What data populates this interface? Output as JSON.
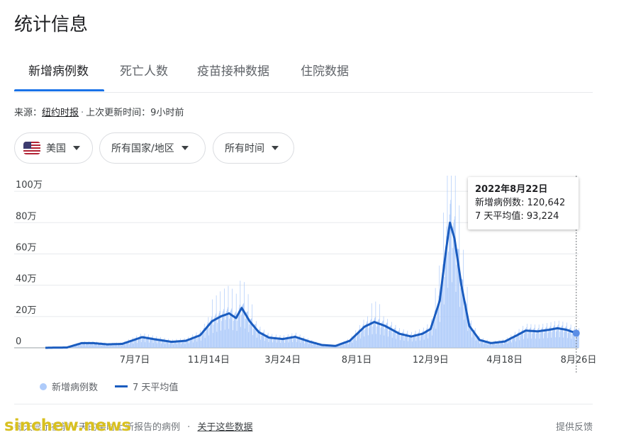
{
  "page": {
    "title": "统计信息",
    "tabs": [
      "新增病例数",
      "死亡人数",
      "疫苗接种数据",
      "住院数据"
    ],
    "source_label": "来源：",
    "source_link": "纽约时报",
    "updated": "上次更新时间：9小时前"
  },
  "filters": {
    "country": "美国",
    "region": "所有国家/地区",
    "time": "所有时间"
  },
  "tooltip": {
    "date": "2022年8月22日",
    "cases": "新增病例数: 120,642",
    "avg": "7 天平均值: 93,224"
  },
  "legend": {
    "bars": "新增病例数",
    "line": "7 天平均值"
  },
  "footer": {
    "note": "每天显示在前一天的某时上新报告的病例",
    "about": "关于这些数据",
    "feedback": "提供反馈"
  },
  "watermark": "sinchew.news",
  "colors": {
    "accent": "#1a73e8",
    "bar": "#aecbfa",
    "line": "#1a5cbf"
  },
  "chart_data": {
    "type": "bar",
    "y_tick_labels": [
      "0",
      "20万",
      "40万",
      "60万",
      "80万",
      "100万"
    ],
    "y_ticks": [
      0,
      200000,
      400000,
      600000,
      800000,
      1000000
    ],
    "ylim": [
      0,
      1100000
    ],
    "x_tick_labels": [
      "7月7日",
      "11月14日",
      "3月24日",
      "8月1日",
      "12月9日",
      "4月18日",
      "8月26日"
    ],
    "x_ticks": [
      "2020-07-07",
      "2020-11-14",
      "2021-03-24",
      "2021-08-01",
      "2021-12-09",
      "2022-04-18",
      "2022-08-26"
    ],
    "x_range": [
      "2020-02-01",
      "2022-08-26"
    ],
    "grid": true,
    "series": [
      {
        "name": "7 天平均值",
        "kind": "line",
        "points": [
          [
            "2020-02-01",
            0
          ],
          [
            "2020-03-10",
            2000
          ],
          [
            "2020-04-05",
            30000
          ],
          [
            "2020-04-25",
            30000
          ],
          [
            "2020-05-20",
            22000
          ],
          [
            "2020-06-15",
            25000
          ],
          [
            "2020-07-20",
            68000
          ],
          [
            "2020-08-10",
            55000
          ],
          [
            "2020-09-10",
            38000
          ],
          [
            "2020-10-05",
            45000
          ],
          [
            "2020-10-30",
            80000
          ],
          [
            "2020-11-20",
            170000
          ],
          [
            "2020-12-05",
            200000
          ],
          [
            "2020-12-20",
            220000
          ],
          [
            "2021-01-01",
            190000
          ],
          [
            "2021-01-11",
            255000
          ],
          [
            "2021-01-25",
            170000
          ],
          [
            "2021-02-10",
            100000
          ],
          [
            "2021-02-28",
            65000
          ],
          [
            "2021-03-24",
            56000
          ],
          [
            "2021-04-15",
            70000
          ],
          [
            "2021-05-10",
            40000
          ],
          [
            "2021-06-01",
            18000
          ],
          [
            "2021-06-25",
            12000
          ],
          [
            "2021-07-20",
            45000
          ],
          [
            "2021-08-15",
            135000
          ],
          [
            "2021-09-01",
            165000
          ],
          [
            "2021-09-20",
            140000
          ],
          [
            "2021-10-15",
            90000
          ],
          [
            "2021-11-05",
            72000
          ],
          [
            "2021-11-25",
            90000
          ],
          [
            "2021-12-09",
            120000
          ],
          [
            "2021-12-25",
            300000
          ],
          [
            "2022-01-05",
            620000
          ],
          [
            "2022-01-12",
            800000
          ],
          [
            "2022-01-20",
            700000
          ],
          [
            "2022-02-01",
            400000
          ],
          [
            "2022-02-15",
            140000
          ],
          [
            "2022-03-05",
            50000
          ],
          [
            "2022-03-25",
            30000
          ],
          [
            "2022-04-18",
            40000
          ],
          [
            "2022-05-10",
            80000
          ],
          [
            "2022-05-25",
            110000
          ],
          [
            "2022-06-15",
            105000
          ],
          [
            "2022-07-05",
            115000
          ],
          [
            "2022-07-20",
            125000
          ],
          [
            "2022-08-05",
            115000
          ],
          [
            "2022-08-22",
            93224
          ],
          [
            "2022-08-26",
            90000
          ]
        ]
      },
      {
        "name": "新增病例数",
        "kind": "bar",
        "highlight": {
          "date": "2022-08-22",
          "value": 120642
        }
      }
    ]
  }
}
